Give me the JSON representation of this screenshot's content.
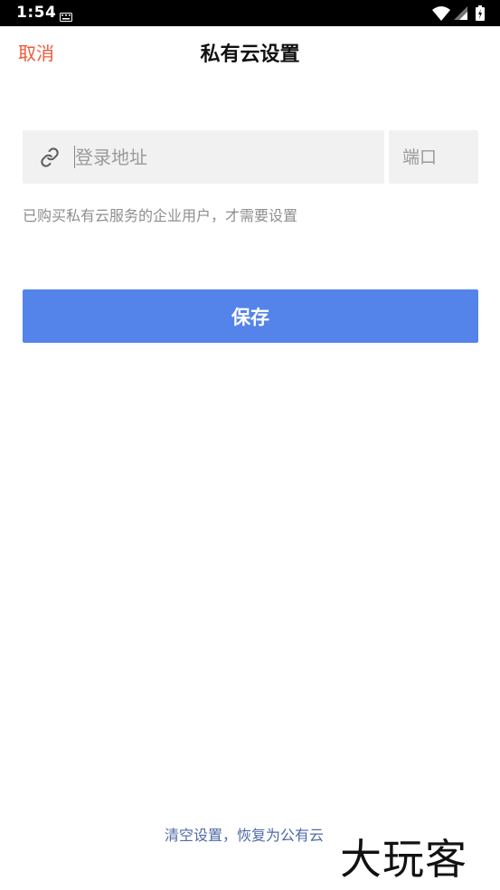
{
  "status_bar": {
    "time": "1:54",
    "icons": [
      "keyboard-icon",
      "wifi-icon",
      "signal-icon",
      "battery-icon"
    ]
  },
  "header": {
    "cancel_label": "取消",
    "title": "私有云设置"
  },
  "form": {
    "url_placeholder": "登录地址",
    "url_value": "",
    "port_placeholder": "端口",
    "port_value": "",
    "hint": "已购买私有云服务的企业用户，才需要设置",
    "save_label": "保存"
  },
  "footer": {
    "reset_label": "清空设置，恢复为公有云",
    "watermark": "大玩客"
  },
  "colors": {
    "accent": "#ee5a3a",
    "primary": "#5483ea",
    "link": "#4f6aa8",
    "field_bg": "#f1f1f1"
  }
}
